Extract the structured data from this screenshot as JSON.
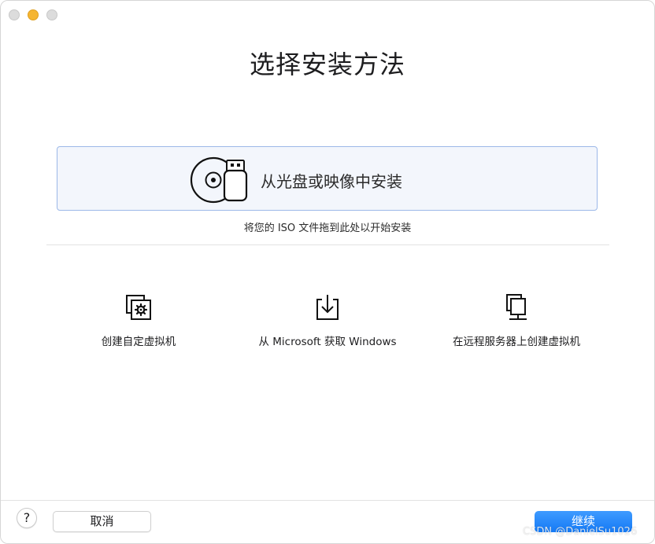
{
  "window": {
    "traffic_lights": [
      {
        "name": "close",
        "color": "#dcdcdc"
      },
      {
        "name": "minimize",
        "color": "#f5b531"
      },
      {
        "name": "zoom",
        "color": "#dcdcdc"
      }
    ]
  },
  "title": "选择安装方法",
  "drop_zone": {
    "label": "从光盘或映像中安装",
    "hint": "将您的 ISO 文件拖到此处以开始安装",
    "icon": "disc-usb-icon"
  },
  "options": [
    {
      "label": "创建自定虚拟机",
      "icon": "custom-vm-icon"
    },
    {
      "label": "从 Microsoft 获取 Windows",
      "icon": "download-icon"
    },
    {
      "label": "在远程服务器上创建虚拟机",
      "icon": "remote-server-icon"
    }
  ],
  "footer": {
    "help_label": "?",
    "cancel_label": "取消",
    "continue_label": "继续"
  },
  "watermark": "CSDN @DanielSu1026",
  "colors": {
    "accent": "#1479f5",
    "drop_zone_bg": "#f3f6fc",
    "drop_zone_border": "#9cb8e8"
  }
}
